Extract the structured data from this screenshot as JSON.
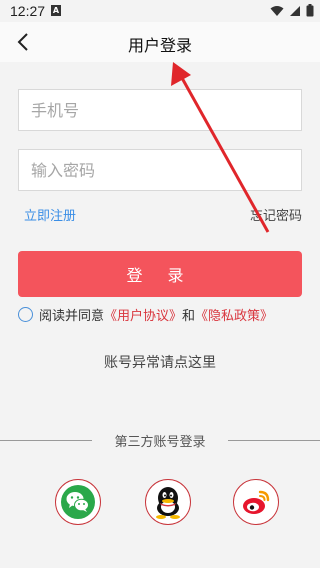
{
  "status_bar": {
    "time": "12:27",
    "notification_letter": "A"
  },
  "header": {
    "title": "用户登录"
  },
  "form": {
    "phone_placeholder": "手机号",
    "password_placeholder": "输入密码"
  },
  "links": {
    "register": "立即注册",
    "forgot_password": "忘记密码"
  },
  "login_button": "登 录",
  "agreement": {
    "prefix": "阅读并同意",
    "user_agreement": "《用户协议》",
    "and": "和",
    "privacy_policy": "《隐私政策》"
  },
  "account_abnormal": "账号异常请点这里",
  "third_party": {
    "title": "第三方账号登录",
    "providers": [
      "wechat-icon",
      "qq-icon",
      "weibo-icon"
    ]
  },
  "colors": {
    "primary": "#f4545c",
    "link": "#3a8ee6",
    "annotation": "#e0262b"
  }
}
